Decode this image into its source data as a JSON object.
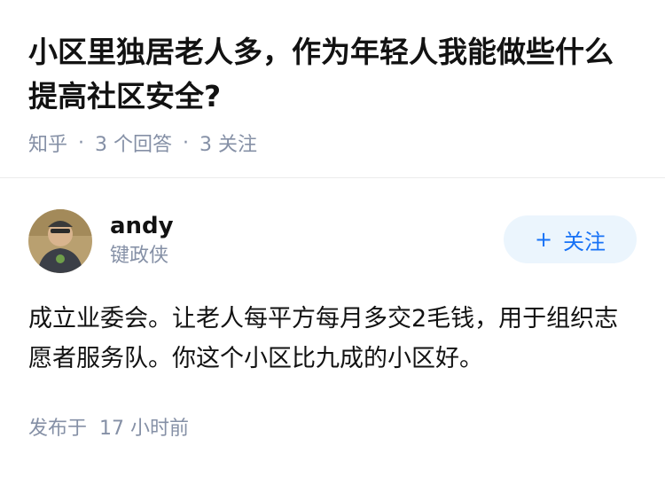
{
  "question": {
    "title": "小区里独居老人多，作为年轻人我能做些什么提高社区安全?",
    "source": "知乎",
    "answer_count": "3 个回答",
    "follow_count": "3 关注"
  },
  "answer": {
    "author": {
      "name": "andy",
      "headline": "键政侠"
    },
    "follow_button": {
      "icon": "+",
      "label": "关注"
    },
    "content": "成立业委会。让老人每平方每月多交2毛钱，用于组织志愿者服务队。你这个小区比九成的小区好。",
    "published_label": "发布于",
    "published_time": "17 小时前"
  },
  "colors": {
    "accent": "#1772f6",
    "button_bg": "#ebf5fd",
    "muted": "#8590a6"
  }
}
